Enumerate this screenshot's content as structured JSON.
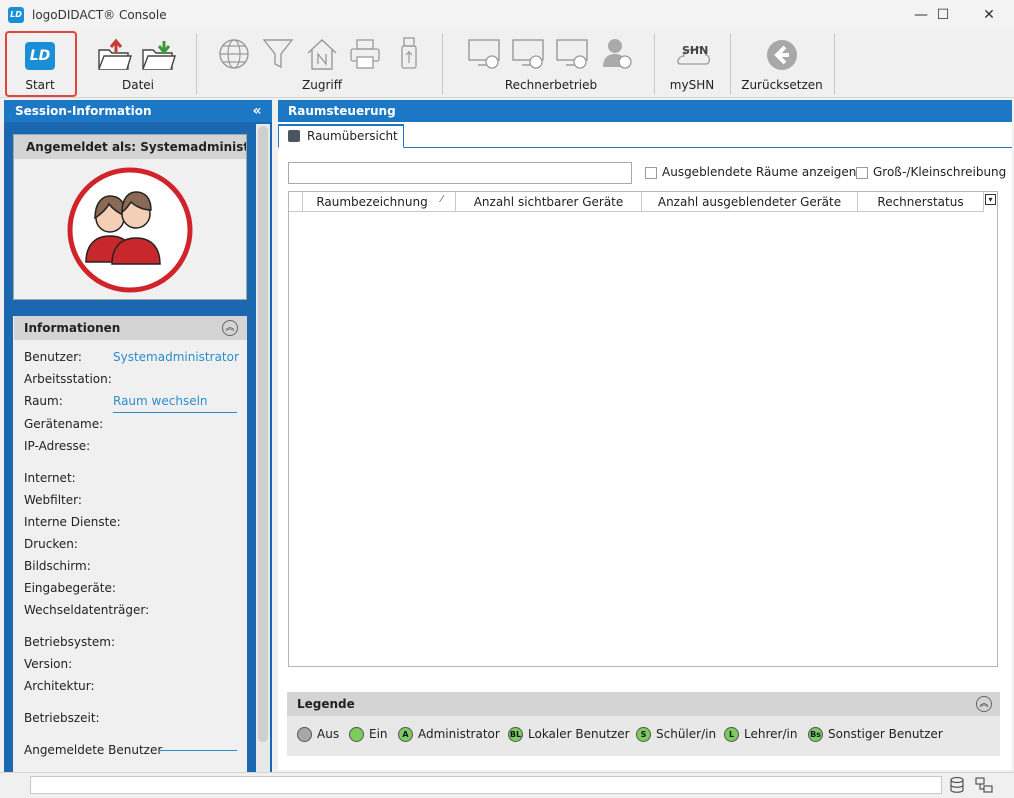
{
  "window": {
    "title": "logoDIDACT® Console",
    "logo": "LD",
    "min": "—",
    "max": "☐",
    "close": "✕"
  },
  "toolbar": {
    "start_label": "Start",
    "datei_label": "Datei",
    "zugriff_label": "Zugriff",
    "rechnerbetrieb_label": "Rechnerbetrieb",
    "myshn_label": "mySHN",
    "myshn_icon_text": "SHN",
    "reset_label": "Zurücksetzen"
  },
  "session": {
    "header": "Session-Information",
    "logged_in_as": "Angemeldet als: Systemadminist...",
    "info_header": "Informationen",
    "rows": [
      {
        "label": "Benutzer:",
        "value": "Systemadministrator"
      },
      {
        "label": "Arbeitsstation:",
        "value": ""
      },
      {
        "label": "Raum:",
        "value": "Raum wechseln"
      },
      {
        "label": "Gerätename:",
        "value": ""
      },
      {
        "label": "IP-Adresse:",
        "value": ""
      },
      {
        "label": "Internet:",
        "value": ""
      },
      {
        "label": "Webfilter:",
        "value": ""
      },
      {
        "label": "Interne Dienste:",
        "value": ""
      },
      {
        "label": "Drucken:",
        "value": ""
      },
      {
        "label": "Bildschirm:",
        "value": ""
      },
      {
        "label": "Eingabegeräte:",
        "value": ""
      },
      {
        "label": "Wechseldatenträger:",
        "value": ""
      },
      {
        "label": "Betriebsystem:",
        "value": ""
      },
      {
        "label": "Version:",
        "value": ""
      },
      {
        "label": "Architektur:",
        "value": ""
      },
      {
        "label": "Betriebszeit:",
        "value": ""
      },
      {
        "label": "Angemeldete Benutzer",
        "value": ""
      }
    ]
  },
  "main": {
    "header": "Raumsteuerung",
    "tab_label": "Raumübersicht",
    "search_value": "",
    "show_hidden_label": "Ausgeblendete Räume anzeigen",
    "case_sensitive_label": "Groß-/Kleinschreibung",
    "columns": [
      "Raumbezeichnung",
      "Anzahl sichtbarer Geräte",
      "Anzahl ausgeblendeter Geräte",
      "Rechnerstatus"
    ],
    "sort_indicator": "⁄"
  },
  "legend": {
    "header": "Legende",
    "items": [
      {
        "badge": "",
        "label": "Aus",
        "color": "#a8a8a8"
      },
      {
        "badge": "",
        "label": "Ein",
        "color": "#7ccc5a"
      },
      {
        "badge": "A",
        "label": "Administrator",
        "color": "#7ccc5a"
      },
      {
        "badge": "BL",
        "label": "Lokaler Benutzer",
        "color": "#7ccc5a"
      },
      {
        "badge": "S",
        "label": "Schüler/in",
        "color": "#7ccc5a"
      },
      {
        "badge": "L",
        "label": "Lehrer/in",
        "color": "#7ccc5a"
      },
      {
        "badge": "Bs",
        "label": "Sonstiger Benutzer",
        "color": "#7ccc5a"
      }
    ]
  },
  "colors": {
    "accent": "#1c78c4",
    "link": "#2b8dcc",
    "highlight": "#e0453f"
  }
}
